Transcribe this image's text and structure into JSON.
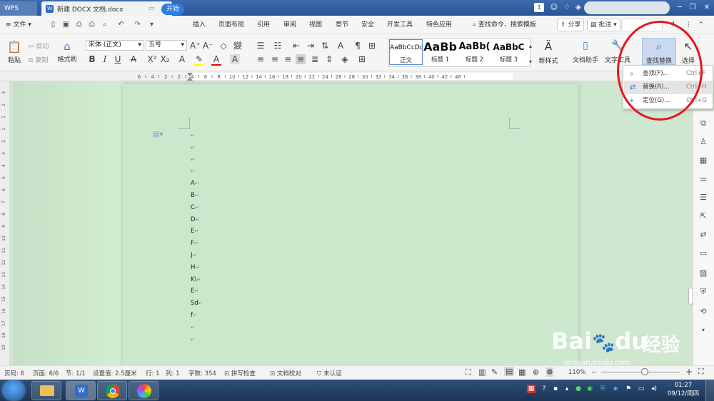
{
  "titlebar": {
    "app_tab": "WPS",
    "doc_tab": "新建 DOCX 文档.docx",
    "doc_icon": "W",
    "new_tab": "+",
    "badge": "1"
  },
  "menubar": {
    "file": "文件",
    "tabs": [
      "开始",
      "插入",
      "页面布局",
      "引用",
      "审阅",
      "视图",
      "章节",
      "安全",
      "开发工具",
      "特色应用"
    ],
    "search": "查找命令、搜索模板",
    "share": "分享",
    "comment": "批注",
    "help": "?"
  },
  "toolbar": {
    "paste": "粘贴",
    "cut": "剪切",
    "copy": "复制",
    "format_painter": "格式刷",
    "font_name": "宋体 (正文)",
    "font_size": "五号",
    "styles": [
      {
        "sample": "AaBbCcDd",
        "label": "正文"
      },
      {
        "sample": "AaBb",
        "label": "标题 1"
      },
      {
        "sample": "AaBb(",
        "label": "标题 2"
      },
      {
        "sample": "AaBbC",
        "label": "标题 3"
      }
    ],
    "new_style": "新样式",
    "doc_assistant": "文档助手",
    "text_tools": "文字工具",
    "find_replace": "查找替换",
    "select": "选择"
  },
  "ruler_numbers": [
    "6",
    "4",
    "2",
    "2",
    "4",
    "6",
    "8",
    "10",
    "12",
    "14",
    "16",
    "18",
    "20",
    "22",
    "24",
    "26",
    "28",
    "30",
    "32",
    "34",
    "36",
    "38",
    "40",
    "42",
    "46"
  ],
  "left_ruler_numbers": [
    "3",
    "2",
    "1",
    "1",
    "2",
    "3",
    "4",
    "5",
    "6",
    "7",
    "8",
    "9",
    "10",
    "11",
    "12",
    "13",
    "14",
    "15",
    "16",
    "17",
    "18",
    "19"
  ],
  "document": {
    "paragraphs": [
      "",
      "",
      "",
      "",
      "A",
      "B",
      "C",
      "D",
      "E",
      "F",
      "J",
      "H",
      "K\\",
      "E",
      "Sd",
      "f",
      "",
      ""
    ]
  },
  "dropdown": {
    "items": [
      {
        "label": "查找(F)...",
        "shortcut": "Ctrl+F",
        "icon": "search-icon"
      },
      {
        "label": "替换(R)...",
        "shortcut": "Ctrl+H",
        "icon": "replace-icon"
      },
      {
        "label": "定位(G)...",
        "shortcut": "Ctrl+G",
        "icon": "goto-icon"
      }
    ]
  },
  "statusbar": {
    "page_num": "页码: 6",
    "pages": "页面: 6/6",
    "section": "节: 1/1",
    "setting": "设置值: 2.5厘米",
    "row": "行: 1",
    "col": "列: 1",
    "words": "字数: 354",
    "spell": "拼写检查",
    "proof": "文档校对",
    "cert": "未认证",
    "zoom": "110%"
  },
  "taskbar": {
    "time": "01:27",
    "date": "09/12/周四"
  },
  "watermark": {
    "brand": "Bai",
    "paw": "du",
    "cn": "经验",
    "url": "jingyan.baidu.com"
  },
  "colors": {
    "accent": "#2f7be0",
    "annotation": "#e5161d",
    "page_bg": "#cce8cc"
  }
}
